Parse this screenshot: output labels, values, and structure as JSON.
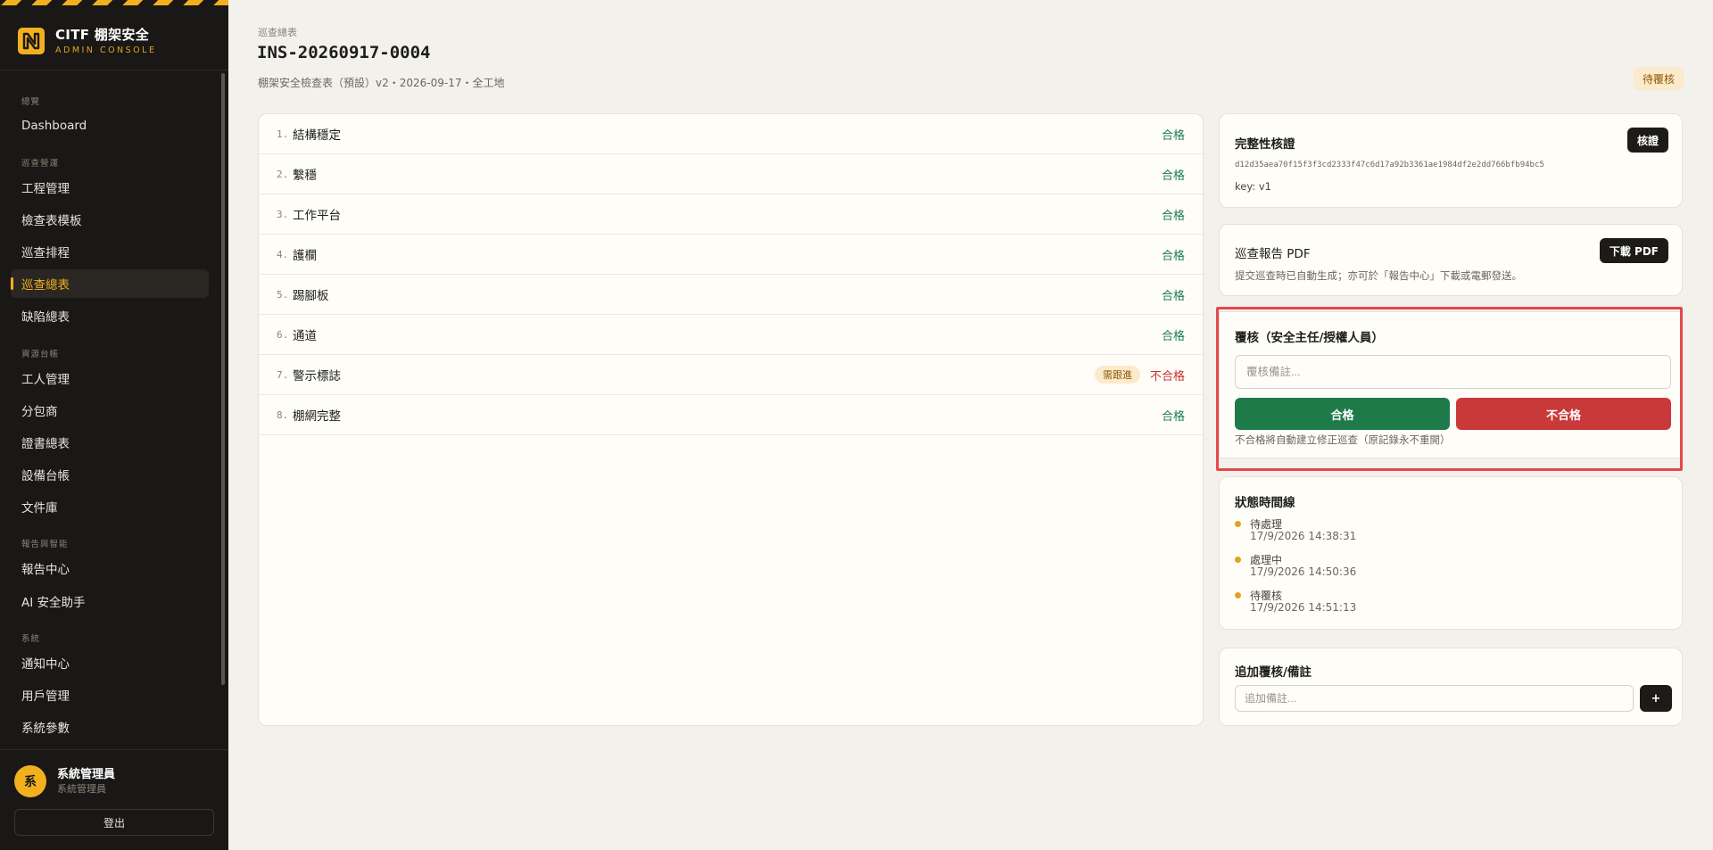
{
  "brand": {
    "title": "CITF 棚架安全",
    "subtitle": "ADMIN CONSOLE"
  },
  "sidebar": {
    "groups": [
      {
        "label": "總覽",
        "items": [
          {
            "label": "Dashboard",
            "active": false
          }
        ]
      },
      {
        "label": "巡查營運",
        "items": [
          {
            "label": "工程管理",
            "active": false
          },
          {
            "label": "檢查表模板",
            "active": false
          },
          {
            "label": "巡查排程",
            "active": false
          },
          {
            "label": "巡查總表",
            "active": true
          },
          {
            "label": "缺陷總表",
            "active": false
          }
        ]
      },
      {
        "label": "資源台帳",
        "items": [
          {
            "label": "工人管理",
            "active": false
          },
          {
            "label": "分包商",
            "active": false
          },
          {
            "label": "證書總表",
            "active": false
          },
          {
            "label": "設備台帳",
            "active": false
          },
          {
            "label": "文件庫",
            "active": false
          }
        ]
      },
      {
        "label": "報告與智能",
        "items": [
          {
            "label": "報告中心",
            "active": false
          },
          {
            "label": "AI 安全助手",
            "active": false
          }
        ]
      },
      {
        "label": "系統",
        "items": [
          {
            "label": "通知中心",
            "active": false
          },
          {
            "label": "用戶管理",
            "active": false
          },
          {
            "label": "系統參數",
            "active": false
          }
        ]
      }
    ]
  },
  "user": {
    "avatar_char": "系",
    "name": "系統管理員",
    "role": "系統管理員",
    "logout_label": "登出"
  },
  "header": {
    "breadcrumb": "巡查總表",
    "title": "INS-20260917-0004",
    "meta": "棚架安全檢查表（預設）v2・2026-09-17・全工地",
    "status": "待覆核"
  },
  "checklist": [
    {
      "num": "1.",
      "label": "結構穩定",
      "result": "合格",
      "tag": ""
    },
    {
      "num": "2.",
      "label": "繫穩",
      "result": "合格",
      "tag": ""
    },
    {
      "num": "3.",
      "label": "工作平台",
      "result": "合格",
      "tag": ""
    },
    {
      "num": "4.",
      "label": "護欄",
      "result": "合格",
      "tag": ""
    },
    {
      "num": "5.",
      "label": "踢腳板",
      "result": "合格",
      "tag": ""
    },
    {
      "num": "6.",
      "label": "通道",
      "result": "合格",
      "tag": ""
    },
    {
      "num": "7.",
      "label": "警示標誌",
      "result": "不合格",
      "tag": "需跟進"
    },
    {
      "num": "8.",
      "label": "棚網完整",
      "result": "合格",
      "tag": ""
    }
  ],
  "integrity": {
    "title": "完整性核證",
    "verify_label": "核證",
    "hash": "d12d35aea70f15f3f3cd2333f47c6d17a92b3361ae1984df2e2dd766bfb94bc5",
    "key": "key: v1"
  },
  "pdf": {
    "title": "巡查報告 PDF",
    "download_label": "下載 PDF",
    "description": "提交巡查時已自動生成；亦可於「報告中心」下載或電郵發送。"
  },
  "review": {
    "title": "覆核（安全主任/授權人員）",
    "placeholder": "覆核備註...",
    "pass_label": "合格",
    "fail_label": "不合格",
    "hint": "不合格將自動建立修正巡查（原記錄永不重開）"
  },
  "timeline": {
    "title": "狀態時間線",
    "items": [
      {
        "label": "待處理",
        "time": "17/9/2026 14:38:31"
      },
      {
        "label": "處理中",
        "time": "17/9/2026 14:50:36"
      },
      {
        "label": "待覆核",
        "time": "17/9/2026 14:51:13"
      }
    ]
  },
  "notes": {
    "title": "追加覆核/備註",
    "placeholder": "追加備註...",
    "add_label": "+"
  },
  "colors": {
    "accent": "#f2b01e",
    "pass": "#1a7d4a",
    "fail": "#c9302c",
    "sidebar_bg": "#1a1816"
  }
}
